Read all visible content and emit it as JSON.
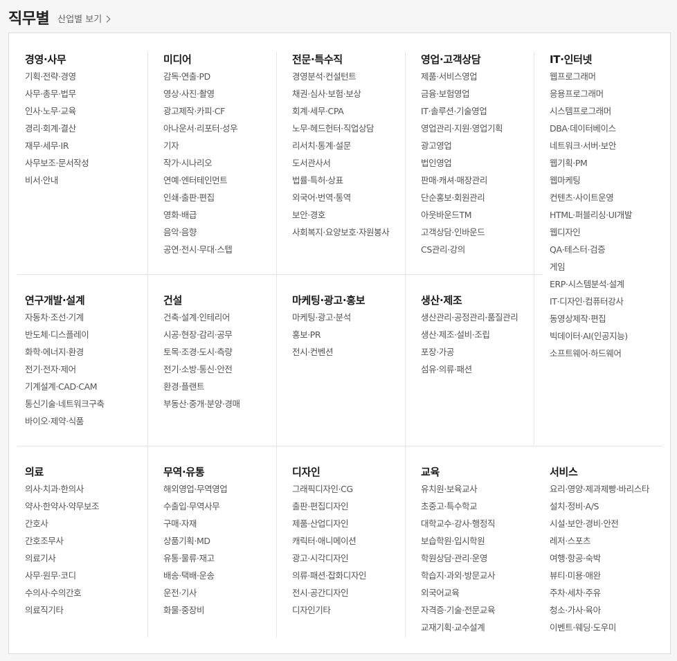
{
  "header": {
    "title": "직무별",
    "link": "산업별 보기"
  },
  "categories": [
    {
      "title": "경영·사무",
      "items": [
        "기획·전략·경영",
        "사무·총무·법무",
        "인사·노무·교육",
        "경리·회계·결산",
        "재무·세무·IR",
        "사무보조·문서작성",
        "비서·안내"
      ]
    },
    {
      "title": "미디어",
      "items": [
        "감독·연출·PD",
        "영상·사진·촬영",
        "광고제작·카피·CF",
        "아나운서·리포터·성우",
        "기자",
        "작가·시나리오",
        "연예·엔터테인먼트",
        "인쇄·출판·편집",
        "영화·배급",
        "음악·음향",
        "공연·전시·무대·스텝"
      ]
    },
    {
      "title": "전문·특수직",
      "items": [
        "경영분석·컨설턴트",
        "채권·심사·보험·보상",
        "회계·세무·CPA",
        "노무·헤드헌터·직업상담",
        "리서치·통계·설문",
        "도서관사서",
        "법률·특허·상표",
        "외국어·번역·통역",
        "보안·경호",
        "사회복지·요양보호·자원봉사"
      ]
    },
    {
      "title": "영업·고객상담",
      "items": [
        "제품·서비스영업",
        "금융·보험영업",
        "IT·솔루션·기술영업",
        "영업관리·지원·영업기획",
        "광고영업",
        "법인영업",
        "판매·캐셔·매장관리",
        "단순홍보·회원관리",
        "아웃바운드TM",
        "고객상담·인바운드",
        "CS관리·강의"
      ]
    },
    {
      "title": "IT·인터넷",
      "items": [
        "웹프로그래머",
        "응용프로그래머",
        "시스템프로그래머",
        "DBA·데이터베이스",
        "네트워크·서버·보안",
        "웹기획·PM",
        "웹마케팅",
        "컨텐츠·사이트운영",
        "HTML·퍼블리싱·UI개발",
        "웹디자인",
        "QA·테스터·검증",
        "게임",
        "ERP·시스템분석·설계",
        "IT·디자인·컴퓨터강사",
        "동영상제작·편집",
        "빅데이터·AI(인공지능)",
        "소프트웨어·하드웨어"
      ]
    },
    {
      "title": "연구개발·설계",
      "items": [
        "자동차·조선·기계",
        "반도체·디스플레이",
        "화학·에너지·환경",
        "전기·전자·제어",
        "기계설계·CAD·CAM",
        "통신기술·네트워크구축",
        "바이오·제약·식품"
      ]
    },
    {
      "title": "건설",
      "items": [
        "건축·설계·인테리어",
        "시공·현장·감리·공무",
        "토목·조경·도시·측량",
        "전기·소방·통신·안전",
        "환경·플랜트",
        "부동산·중개·분양·경매"
      ]
    },
    {
      "title": "마케팅·광고·홍보",
      "items": [
        "마케팅·광고·분석",
        "홍보·PR",
        "전시·컨벤션"
      ]
    },
    {
      "title": "생산·제조",
      "items": [
        "생산관리·공정관리·품질관리",
        "생산·제조·설비·조립",
        "포장·가공",
        "섬유·의류·패션"
      ]
    },
    {
      "title": "의료",
      "items": [
        "의사·치과·한의사",
        "약사·한약사·약무보조",
        "간호사",
        "간호조무사",
        "의료기사",
        "사무·원무·코디",
        "수의사·수의간호",
        "의료직기타"
      ]
    },
    {
      "title": "무역·유통",
      "items": [
        "해외영업·무역영업",
        "수출입·무역사무",
        "구매·자재",
        "상품기획·MD",
        "유통·물류·재고",
        "배송·택배·운송",
        "운전·기사",
        "화물·중장비"
      ]
    },
    {
      "title": "디자인",
      "items": [
        "그래픽디자인·CG",
        "출판·편집디자인",
        "제품·산업디자인",
        "캐릭터·애니메이션",
        "광고·시각디자인",
        "의류·패션·잡화디자인",
        "전시·공간디자인",
        "디자인기타"
      ]
    },
    {
      "title": "교육",
      "items": [
        "유치원·보육교사",
        "초중고·특수학교",
        "대학교수·강사·행정직",
        "보습학원·입시학원",
        "학원상담·관리·운영",
        "학습지·과외·방문교사",
        "외국어교육",
        "자격증·기술·전문교육",
        "교재기획·교수설계"
      ]
    },
    {
      "title": "서비스",
      "items": [
        "요리·영양·제과제빵·바리스타",
        "설치·정비·A/S",
        "시설·보안·경비·안전",
        "레저·스포츠",
        "여행·항공·숙박",
        "뷰티·미용·애완",
        "주차·세차·주유",
        "청소·가사·육아",
        "이벤트·웨딩·도우미"
      ]
    }
  ]
}
